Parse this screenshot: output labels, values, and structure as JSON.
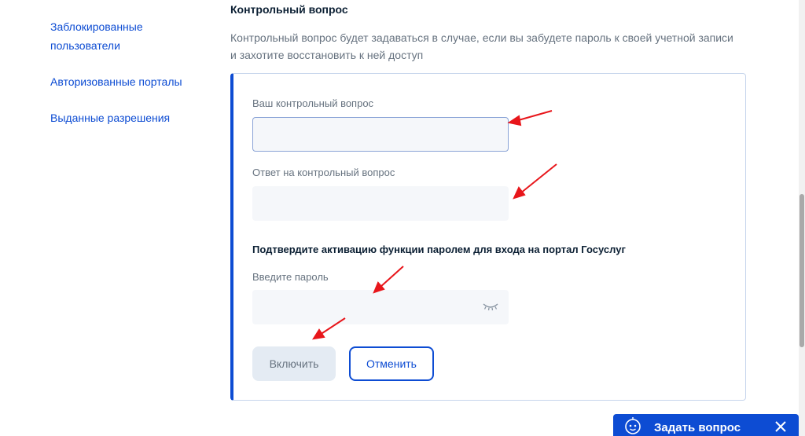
{
  "sidebar": {
    "items": [
      {
        "label": "Заблокированные пользователи"
      },
      {
        "label": "Авторизованные порталы"
      },
      {
        "label": "Выданные разрешения"
      }
    ]
  },
  "section": {
    "title": "Контрольный вопрос",
    "description": "Контрольный вопрос будет задаваться в случае, если вы забудете пароль к своей учетной записи и захотите восстановить к ней доступ"
  },
  "form": {
    "question_label": "Ваш контрольный вопрос",
    "question_value": "",
    "answer_label": "Ответ на контрольный вопрос",
    "answer_value": "",
    "confirm_text": "Подтвердите активацию функции паролем для входа на портал Госуслуг",
    "password_label": "Введите пароль",
    "password_value": "",
    "password_icon": "eye-closed-icon",
    "enable_button": "Включить",
    "cancel_button": "Отменить"
  },
  "help_widget": {
    "label": "Задать вопрос",
    "icon": "robot-assistant-icon",
    "close_icon": "close-icon"
  },
  "colors": {
    "accent": "#0d4cd3",
    "annotation_arrow": "#e8161b",
    "muted_text": "#66727f",
    "field_bg": "#f5f7fa"
  }
}
